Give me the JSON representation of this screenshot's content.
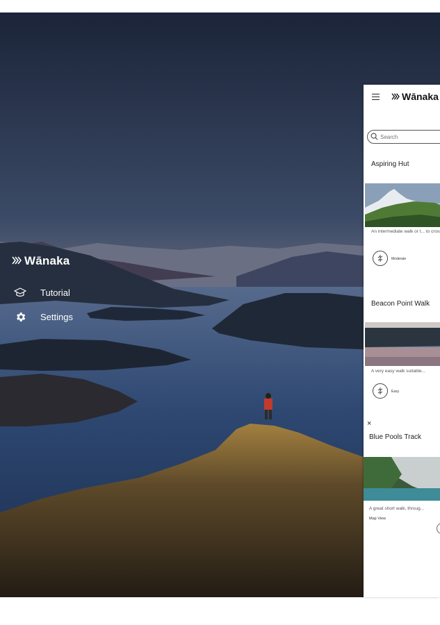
{
  "sidebar": {
    "brand": "Wānaka",
    "items": [
      {
        "label": "Tutorial",
        "icon": "graduation-cap-icon"
      },
      {
        "label": "Settings",
        "icon": "gear-icon"
      }
    ]
  },
  "panel": {
    "brand": "Wānaka",
    "search_placeholder": "Search",
    "cards": [
      {
        "title": "Aspiring Hut",
        "description": "An intermediate walk or t... to cross",
        "difficulty": "Moderate"
      },
      {
        "title": "Beacon Point Walk",
        "description": "A very easy walk suitable...",
        "difficulty": "Easy"
      },
      {
        "title": "Blue Pools Track",
        "description": "A great short walk, throug...",
        "link": "Map View"
      }
    ],
    "close_symbol": "×"
  },
  "colors": {
    "sky_top": "#1e2a40",
    "sky_horizon": "#c9a47e",
    "lake": "#2f4a72",
    "panel_bg": "#ffffff",
    "text_white": "#ffffff"
  }
}
